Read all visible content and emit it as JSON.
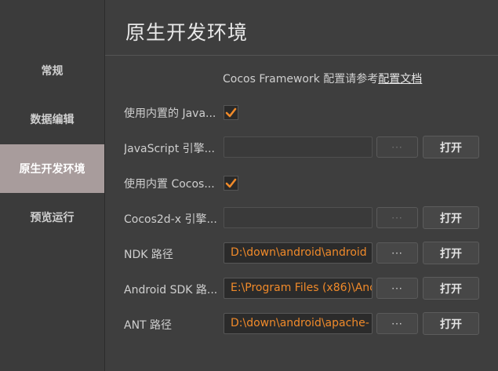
{
  "sidebar": {
    "items": [
      {
        "label": "常规"
      },
      {
        "label": "数据编辑"
      },
      {
        "label": "原生开发环境"
      },
      {
        "label": "预览运行"
      }
    ]
  },
  "main": {
    "title": "原生开发环境",
    "hint_text": "Cocos Framework 配置请参考",
    "hint_link": "配置文档",
    "rows": {
      "use_builtin_js_label": "使用内置的 Java...",
      "js_engine_label": "JavaScript 引擎...",
      "use_builtin_cocos_label": "使用内置 Cocos...",
      "cocos2dx_engine_label": "Cocos2d-x 引擎...",
      "ndk_label": "NDK 路径",
      "ndk_value": "D:\\down\\android\\android",
      "android_sdk_label": "Android SDK 路...",
      "android_sdk_value": "E:\\Program Files (x86)\\Anc",
      "ant_label": "ANT 路径",
      "ant_value": "D:\\down\\android\\apache-"
    },
    "browse_label": "···",
    "open_label": "打开",
    "checkbox_color": "#f08a2a",
    "path_text_color": "#f08a2a"
  }
}
